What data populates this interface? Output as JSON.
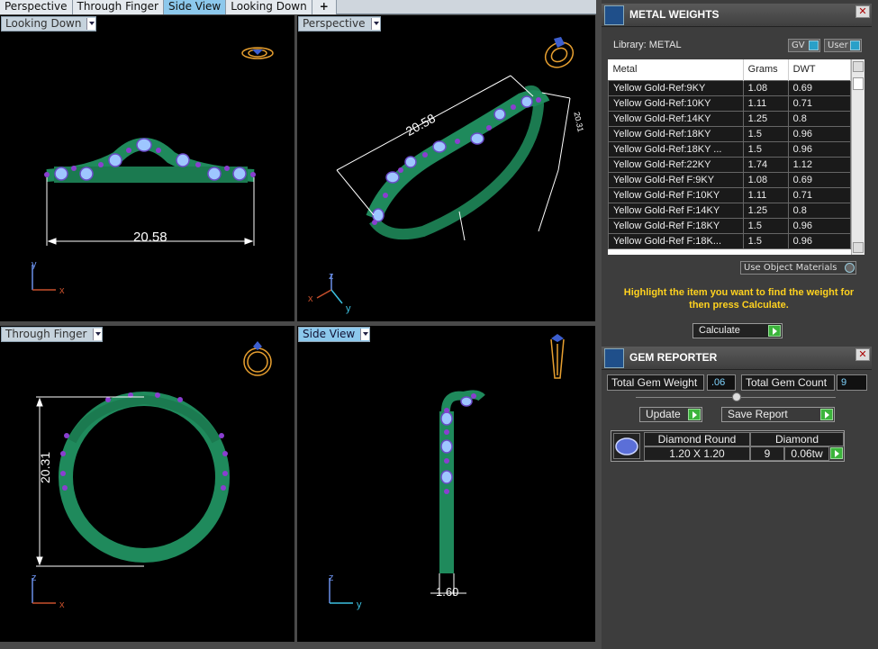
{
  "tabs": [
    "Perspective",
    "Through Finger",
    "Side View",
    "Looking Down",
    "+"
  ],
  "active_tab_index": 2,
  "viewports": {
    "top_left": {
      "label": "Looking Down",
      "dimension": "20.58",
      "axis_a": "y",
      "axis_b": "x"
    },
    "top_right": {
      "label": "Perspective",
      "dimension": "20.58",
      "dimension2": "20.31",
      "axis_z": "z",
      "axis_x": "x",
      "axis_y": "y"
    },
    "bottom_left": {
      "label": "Through Finger",
      "dimension": "20.31",
      "axis_a": "z",
      "axis_b": "x"
    },
    "bottom_right": {
      "label": "Side View",
      "dimension": "1.60",
      "axis_a": "z",
      "axis_b": "y"
    }
  },
  "metal_weights": {
    "title": "METAL WEIGHTS",
    "library_label": "Library: METAL",
    "gv_label": "GV",
    "user_label": "User",
    "columns": [
      "Metal",
      "Grams",
      "DWT"
    ],
    "rows": [
      [
        "Yellow Gold-Ref:9KY",
        "1.08",
        "0.69"
      ],
      [
        "Yellow Gold-Ref:10KY",
        "1.11",
        "0.71"
      ],
      [
        "Yellow Gold-Ref:14KY",
        "1.25",
        "0.8"
      ],
      [
        "Yellow Gold-Ref:18KY",
        "1.5",
        "0.96"
      ],
      [
        "Yellow Gold-Ref:18KY ...",
        "1.5",
        "0.96"
      ],
      [
        "Yellow Gold-Ref:22KY",
        "1.74",
        "1.12"
      ],
      [
        "Yellow Gold-Ref F:9KY",
        "1.08",
        "0.69"
      ],
      [
        "Yellow Gold-Ref F:10KY",
        "1.11",
        "0.71"
      ],
      [
        "Yellow Gold-Ref F:14KY",
        "1.25",
        "0.8"
      ],
      [
        "Yellow Gold-Ref F:18KY",
        "1.5",
        "0.96"
      ],
      [
        "Yellow Gold-Ref F:18K...",
        "1.5",
        "0.96"
      ]
    ],
    "use_object_label": "Use Object Materials",
    "hint": "Highlight the item you want to find the weight for then press Calculate.",
    "calculate_label": "Calculate"
  },
  "gem_reporter": {
    "title": "GEM REPORTER",
    "total_weight_label": "Total Gem Weight",
    "total_weight_value": ".06",
    "total_count_label": "Total Gem Count",
    "total_count_value": "9",
    "update_label": "Update",
    "save_label": "Save Report",
    "gem": {
      "shape": "Diamond Round",
      "size": "1.20 X 1.20",
      "type": "Diamond",
      "count": "9",
      "weight": "0.06tw"
    }
  },
  "colors": {
    "ring": "#1f8a5c",
    "gem": "#8fb8ff",
    "prong": "#8a3fd0",
    "dim_line": "#ffffff",
    "hint": "#ffd21f"
  }
}
